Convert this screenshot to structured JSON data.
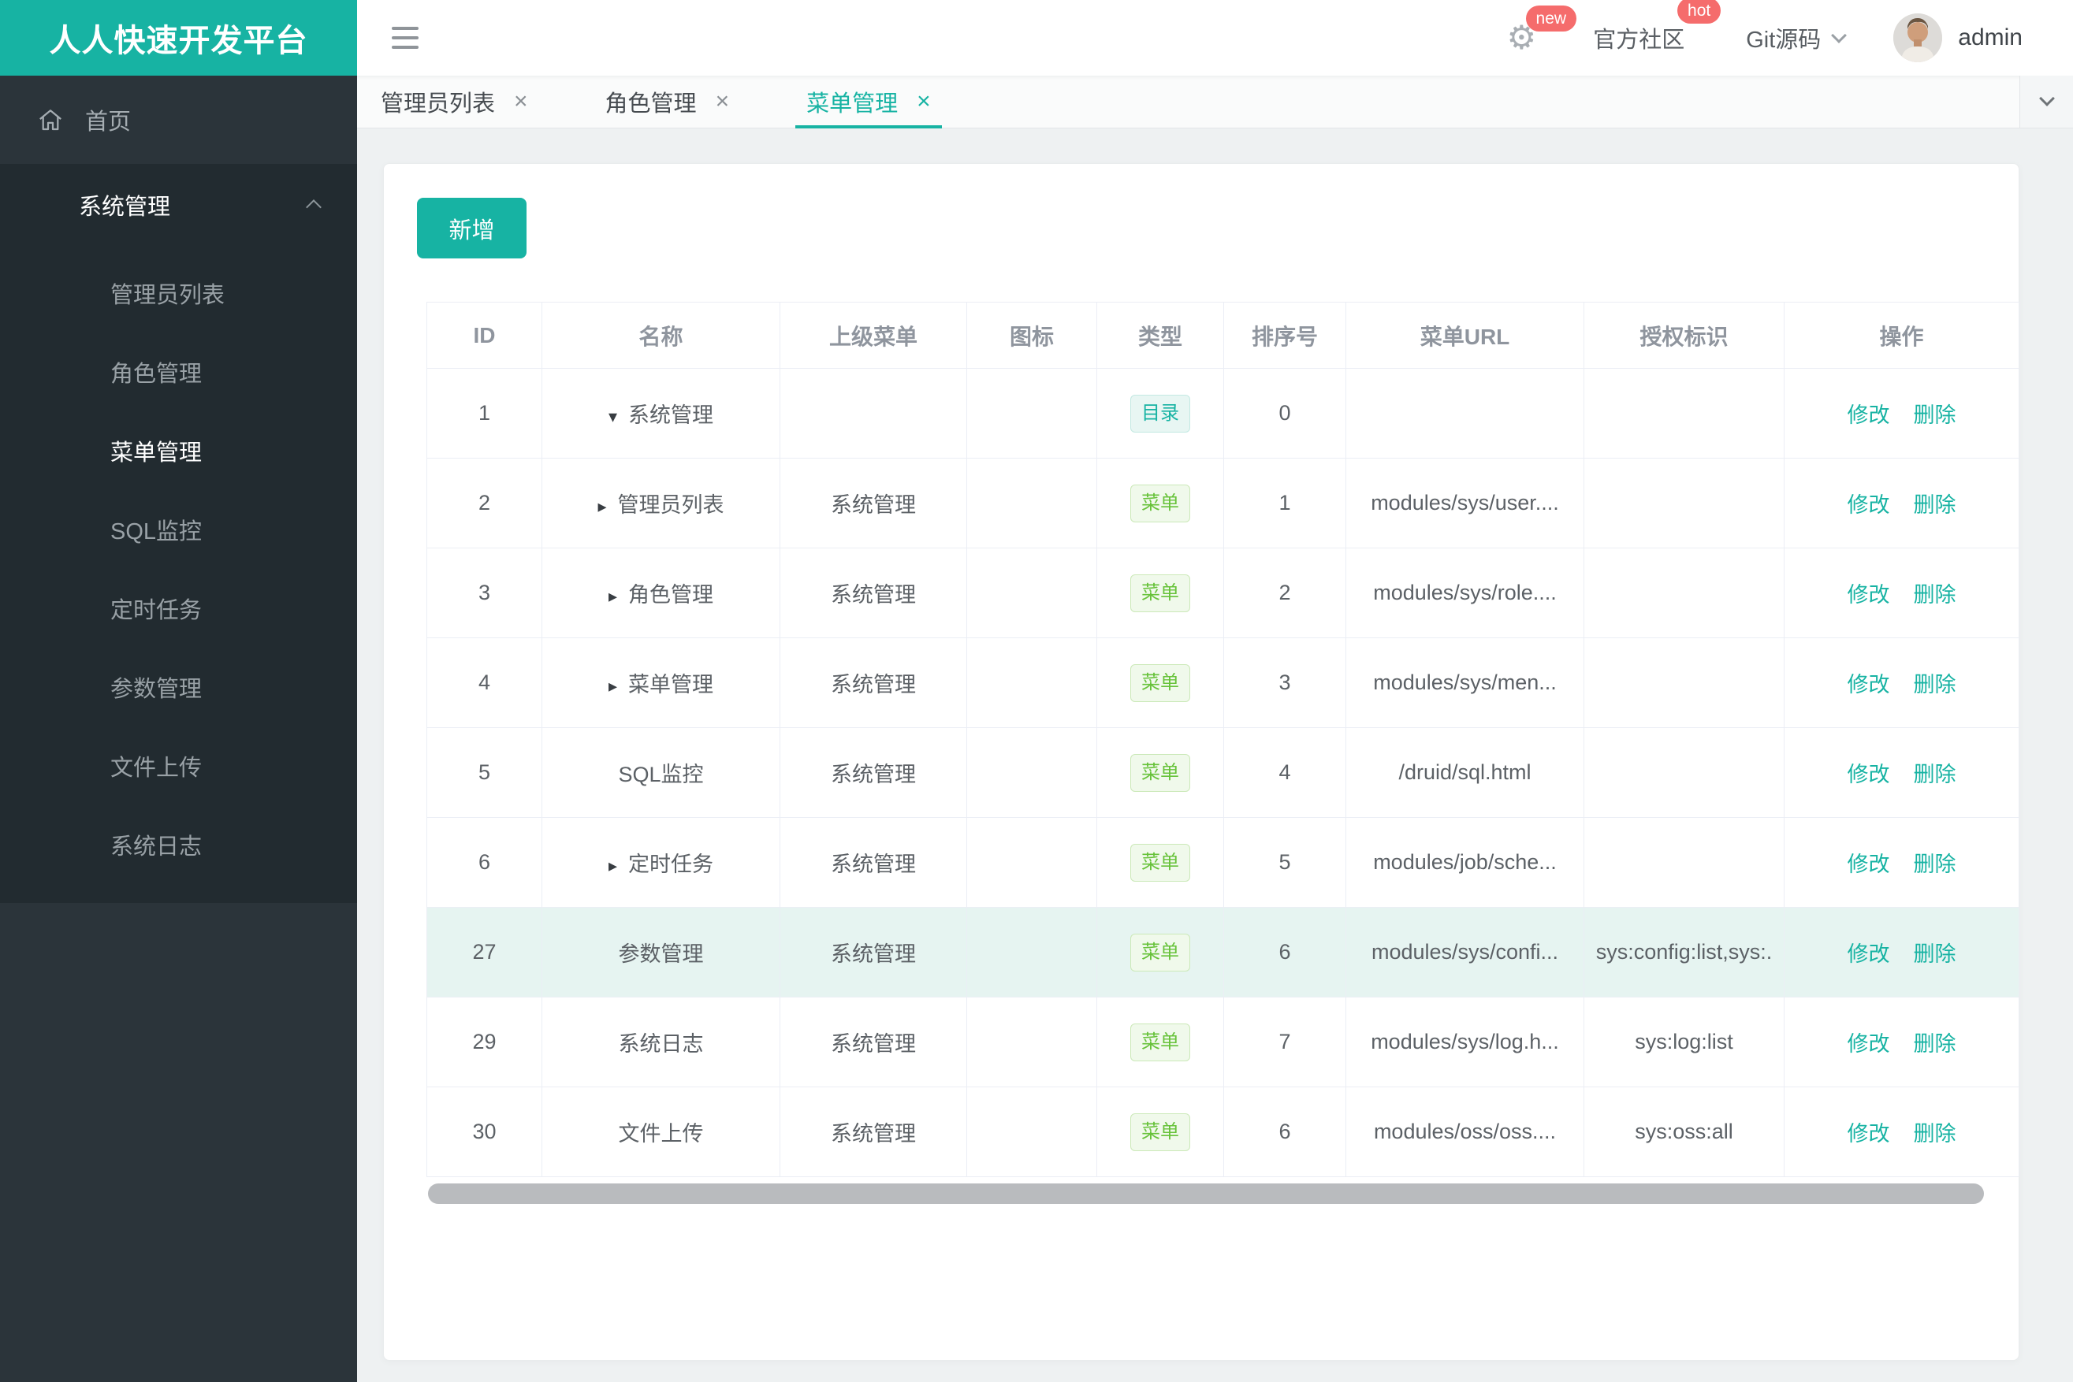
{
  "app": {
    "title": "人人快速开发平台"
  },
  "header": {
    "new_badge": "new",
    "community_label": "官方社区",
    "hot_badge": "hot",
    "git_label": "Git源码",
    "user": "admin"
  },
  "sidebar": {
    "home_label": "首页",
    "group_label": "系统管理",
    "active_item": "菜单管理",
    "items": [
      "管理员列表",
      "角色管理",
      "菜单管理",
      "SQL监控",
      "定时任务",
      "参数管理",
      "文件上传",
      "系统日志"
    ]
  },
  "tabs": [
    {
      "label": "管理员列表",
      "active": false
    },
    {
      "label": "角色管理",
      "active": false
    },
    {
      "label": "菜单管理",
      "active": true
    }
  ],
  "toolbar": {
    "add_label": "新增"
  },
  "table": {
    "columns": [
      "ID",
      "名称",
      "上级菜单",
      "图标",
      "类型",
      "排序号",
      "菜单URL",
      "授权标识",
      "操作"
    ],
    "type_labels": {
      "dir": "目录",
      "menu": "菜单"
    },
    "actions": {
      "edit": "修改",
      "delete": "删除"
    },
    "rows": [
      {
        "id": "1",
        "arrow": "down",
        "name": "系统管理",
        "parent": "",
        "icon": "",
        "type": "dir",
        "order": "0",
        "url": "",
        "perm": "",
        "highlight": false
      },
      {
        "id": "2",
        "arrow": "right",
        "name": "管理员列表",
        "parent": "系统管理",
        "icon": "",
        "type": "menu",
        "order": "1",
        "url": "modules/sys/user....",
        "perm": "",
        "highlight": false
      },
      {
        "id": "3",
        "arrow": "right",
        "name": "角色管理",
        "parent": "系统管理",
        "icon": "",
        "type": "menu",
        "order": "2",
        "url": "modules/sys/role....",
        "perm": "",
        "highlight": false
      },
      {
        "id": "4",
        "arrow": "right",
        "name": "菜单管理",
        "parent": "系统管理",
        "icon": "",
        "type": "menu",
        "order": "3",
        "url": "modules/sys/men...",
        "perm": "",
        "highlight": false
      },
      {
        "id": "5",
        "arrow": "none",
        "name": "SQL监控",
        "parent": "系统管理",
        "icon": "",
        "type": "menu",
        "order": "4",
        "url": "/druid/sql.html",
        "perm": "",
        "highlight": false
      },
      {
        "id": "6",
        "arrow": "right",
        "name": "定时任务",
        "parent": "系统管理",
        "icon": "",
        "type": "menu",
        "order": "5",
        "url": "modules/job/sche...",
        "perm": "",
        "highlight": false
      },
      {
        "id": "27",
        "arrow": "none",
        "name": "参数管理",
        "parent": "系统管理",
        "icon": "",
        "type": "menu",
        "order": "6",
        "url": "modules/sys/confi...",
        "perm": "sys:config:list,sys:.",
        "highlight": true
      },
      {
        "id": "29",
        "arrow": "none",
        "name": "系统日志",
        "parent": "系统管理",
        "icon": "",
        "type": "menu",
        "order": "7",
        "url": "modules/sys/log.h...",
        "perm": "sys:log:list",
        "highlight": false
      },
      {
        "id": "30",
        "arrow": "none",
        "name": "文件上传",
        "parent": "系统管理",
        "icon": "",
        "type": "menu",
        "order": "6",
        "url": "modules/oss/oss....",
        "perm": "sys:oss:all",
        "highlight": false
      }
    ]
  },
  "icons": {
    "gear": "⚙",
    "close": "×",
    "tree_down": "▾",
    "tree_right": "▸"
  },
  "colors": {
    "primary": "#17b3a3",
    "danger": "#f56c6c",
    "success": "#67c23a",
    "row_highlight": "#e6f4f1"
  }
}
